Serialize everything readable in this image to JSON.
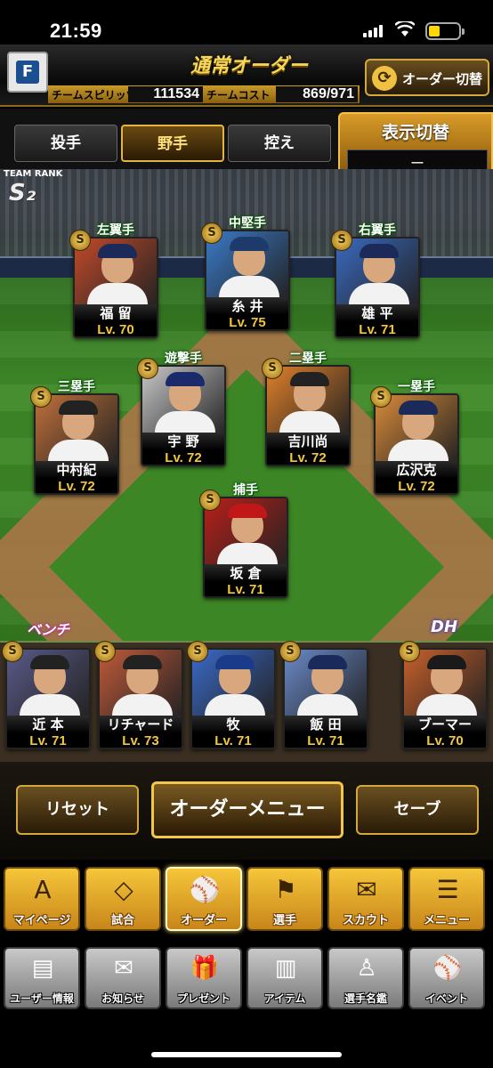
{
  "status_bar": {
    "time": "21:59"
  },
  "header": {
    "title": "通常オーダー",
    "team_spirits_label": "チームスピリッツ",
    "team_spirits_value": "111534",
    "team_cost_label": "チームコスト",
    "team_cost_value": "869/971",
    "order_switch_label": "オーダー切替",
    "home_logo": "F"
  },
  "tabs": [
    {
      "label": "投手",
      "active": false
    },
    {
      "label": "野手",
      "active": true
    },
    {
      "label": "控え",
      "active": false
    }
  ],
  "display_switch": {
    "title": "表示切替",
    "value": "ー"
  },
  "team_rank": {
    "label": "TEAM RANK",
    "rank": "S₂"
  },
  "field_players": [
    {
      "position": "左翼手",
      "name": "福 留",
      "level": "Lv. 70",
      "badge": "S",
      "cap": "#1c2a5a",
      "bg": "#c04a2a"
    },
    {
      "position": "中堅手",
      "name": "糸 井",
      "level": "Lv. 75",
      "badge": "S",
      "cap": "#1c3a6a",
      "bg": "#3a7ac8"
    },
    {
      "position": "右翼手",
      "name": "雄 平",
      "level": "Lv. 71",
      "badge": "S",
      "cap": "#1c2a5a",
      "bg": "#3a6ac0"
    },
    {
      "position": "遊撃手",
      "name": "宇 野",
      "level": "Lv. 72",
      "badge": "S",
      "cap": "#1a2a6a",
      "bg": "#c8c8c8"
    },
    {
      "position": "二塁手",
      "name": "吉川尚",
      "level": "Lv. 72",
      "badge": "S",
      "cap": "#222",
      "bg": "#e0802a"
    },
    {
      "position": "三塁手",
      "name": "中村紀",
      "level": "Lv. 72",
      "badge": "S",
      "cap": "#222",
      "bg": "#c0703a"
    },
    {
      "position": "一塁手",
      "name": "広沢克",
      "level": "Lv. 72",
      "badge": "S",
      "cap": "#1c2a5a",
      "bg": "#d88a3a"
    },
    {
      "position": "捕手",
      "name": "坂 倉",
      "level": "Lv. 71",
      "badge": "S",
      "cap": "#c01818",
      "bg": "#b8201a"
    }
  ],
  "bench_label": "ベンチ",
  "dh_label": "DH",
  "bench_players": [
    {
      "name": "近 本",
      "level": "Lv. 71",
      "badge": "S",
      "cap": "#222",
      "bg": "#5a5a8a"
    },
    {
      "name": "リチャード",
      "level": "Lv. 73",
      "badge": "S",
      "cap": "#222",
      "bg": "#c05a3a"
    },
    {
      "name": "牧",
      "level": "Lv. 71",
      "badge": "S",
      "cap": "#1a3a8a",
      "bg": "#3a6ac8"
    },
    {
      "name": "飯 田",
      "level": "Lv. 71",
      "badge": "S",
      "cap": "#1a2a5a",
      "bg": "#6a8ac8"
    },
    {
      "name": "ブーマー",
      "level": "Lv. 70",
      "badge": "S",
      "cap": "#1a1a1a",
      "bg": "#c8602a"
    }
  ],
  "actions": {
    "reset": "リセット",
    "order_menu": "オーダーメニュー",
    "save": "セーブ"
  },
  "nav_primary": [
    {
      "label": "マイページ",
      "icon": "A"
    },
    {
      "label": "試合",
      "icon": "◇"
    },
    {
      "label": "オーダー",
      "icon": "⚾"
    },
    {
      "label": "選手",
      "icon": "⚑"
    },
    {
      "label": "スカウト",
      "icon": "✉"
    },
    {
      "label": "メニュー",
      "icon": "☰"
    }
  ],
  "nav_secondary": [
    {
      "label": "ユーザー情報",
      "icon": "▤"
    },
    {
      "label": "お知らせ",
      "icon": "✉"
    },
    {
      "label": "プレゼント",
      "icon": "🎁"
    },
    {
      "label": "アイテム",
      "icon": "▥"
    },
    {
      "label": "選手名鑑",
      "icon": "♙"
    },
    {
      "label": "イベント",
      "icon": "⚾"
    }
  ]
}
